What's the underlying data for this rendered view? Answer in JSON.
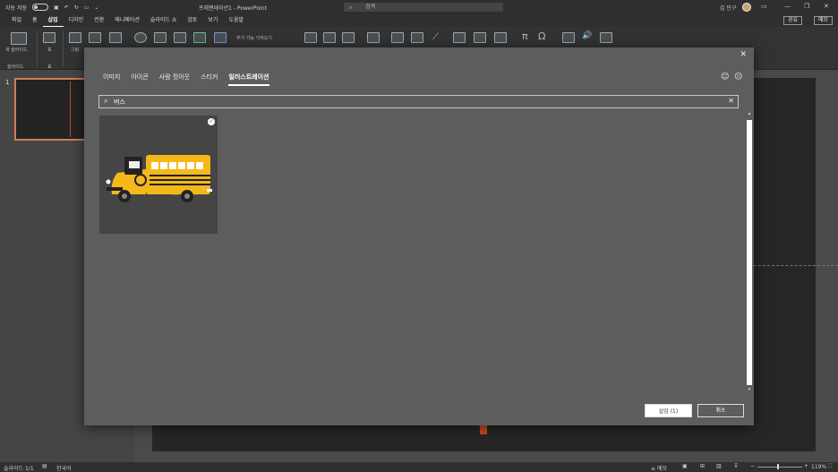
{
  "titlebar": {
    "autosave_label": "자동 저장",
    "doc_title": "프레젠테이션1 - PowerPoint",
    "search_placeholder": "검색",
    "user_name": "김 민구"
  },
  "menu": {
    "items": [
      "파일",
      "홈",
      "삽입",
      "디자인",
      "전환",
      "애니메이션",
      "슬라이드 쇼",
      "검토",
      "보기",
      "도움말"
    ],
    "active": "삽입",
    "share_label": "공유",
    "memo_label": "메모"
  },
  "ribbon": {
    "new_slide": "새 슬라이드",
    "table": "표",
    "image": "그림",
    "addins": "추가 기능 가져오기",
    "group_slides": "슬라이드",
    "group_table": "표"
  },
  "thumbnails": {
    "slide_number": "1"
  },
  "dialog": {
    "tabs": [
      "이미지",
      "아이콘",
      "사람 컷아웃",
      "스티커",
      "일러스트레이션"
    ],
    "active_tab": "일러스트레이션",
    "search_value": "버스",
    "insert_label": "삽입 (1)",
    "cancel_label": "취소",
    "results": [
      {
        "name": "school-bus-illustration",
        "selected": true
      }
    ]
  },
  "status": {
    "slide_info": "슬라이드 1/1",
    "language": "한국어",
    "notes_label": "메모",
    "zoom": "119%"
  },
  "colors": {
    "accent": "#c84a1e",
    "bus_yellow": "#f5b81b"
  }
}
